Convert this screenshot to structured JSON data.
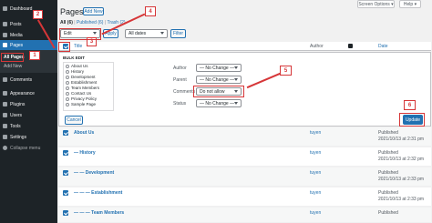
{
  "sidebar": {
    "items": [
      {
        "label": "Dashboard",
        "icon": "dashboard-icon"
      },
      {
        "label": "Posts",
        "icon": "pin-icon"
      },
      {
        "label": "Media",
        "icon": "media-icon"
      },
      {
        "label": "Pages",
        "icon": "page-icon"
      },
      {
        "label": "Comments",
        "icon": "comment-icon"
      },
      {
        "label": "Appearance",
        "icon": "brush-icon"
      },
      {
        "label": "Plugins",
        "icon": "plugin-icon"
      },
      {
        "label": "Users",
        "icon": "user-icon"
      },
      {
        "label": "Tools",
        "icon": "wrench-icon"
      },
      {
        "label": "Settings",
        "icon": "settings-icon"
      },
      {
        "label": "Collapse menu",
        "icon": "collapse-icon"
      }
    ],
    "submenu": [
      "All Pages",
      "Add New"
    ]
  },
  "header": {
    "title": "Pages",
    "add_new": "Add New",
    "screen_options": "Screen Options ▾",
    "help": "Help ▾",
    "filters": {
      "all": "All (6)",
      "sep1": "|",
      "published": "Published (6)",
      "sep2": "|",
      "trash": "Trash (2)"
    }
  },
  "toolbar": {
    "bulk_value": "Edit",
    "apply": "Apply",
    "dates_value": "All dates",
    "filter": "Filter"
  },
  "table": {
    "col_title": "Title",
    "col_author": "Author",
    "col_date": "Date"
  },
  "bulk_edit": {
    "heading": "BULK EDIT",
    "pages": [
      "About Us",
      "History",
      "Development",
      "Establishment",
      "Team Members",
      "Contact Us",
      "Privacy Policy",
      "Sample Page"
    ],
    "fields": [
      {
        "label": "Author",
        "value": "— No Change —"
      },
      {
        "label": "Parent",
        "value": "— No Change —"
      },
      {
        "label": "Comments",
        "value": "Do not allow"
      },
      {
        "label": "Status",
        "value": "— No Change —"
      }
    ],
    "cancel": "Cancel",
    "update": "Update"
  },
  "rows": [
    {
      "title": "About Us",
      "author": "tuyen",
      "status": "Published",
      "date": "2021/10/13 at 2:31 pm"
    },
    {
      "title": "— History",
      "author": "tuyen",
      "status": "Published",
      "date": "2021/10/13 at 2:32 pm"
    },
    {
      "title": "— — Development",
      "author": "tuyen",
      "status": "Published",
      "date": "2021/10/13 at 2:33 pm"
    },
    {
      "title": "— — — Establishment",
      "author": "tuyen",
      "status": "Published",
      "date": "2021/10/13 at 2:33 pm"
    },
    {
      "title": "— — — Team Members",
      "author": "tuyen",
      "status": "Published",
      "date": ""
    }
  ],
  "callouts": [
    "1",
    "2",
    "3",
    "4",
    "5",
    "6"
  ],
  "colors": {
    "accent": "#2271b1",
    "sidebar": "#1d2327",
    "callout": "#d63638"
  }
}
